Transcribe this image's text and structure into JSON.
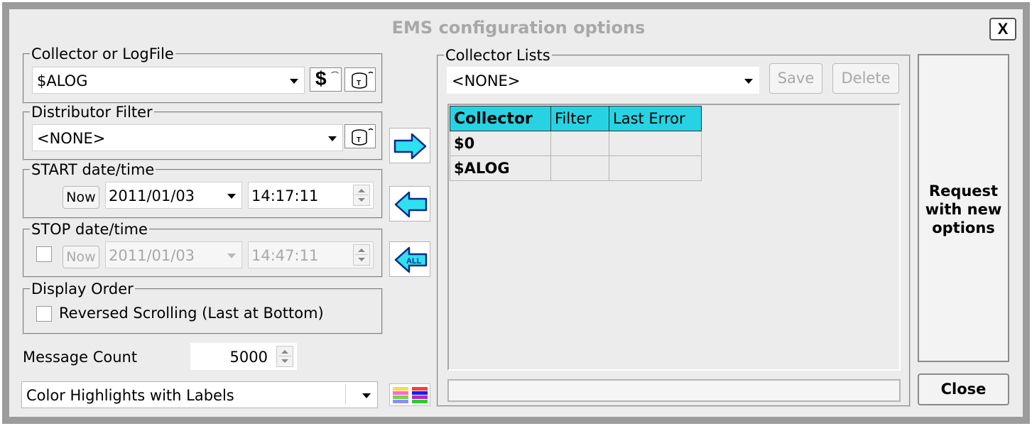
{
  "dialog": {
    "title": "EMS configuration options",
    "close_x": "X"
  },
  "collector_group": {
    "legend": "Collector or LogFile",
    "value": "$ALOG"
  },
  "distributor_group": {
    "legend": "Distributor Filter",
    "value": "<NONE>"
  },
  "start_group": {
    "legend": "START date/time",
    "now_label": "Now",
    "date": "2011/01/03",
    "time": "14:17:11"
  },
  "stop_group": {
    "legend": "STOP date/time",
    "now_label": "Now",
    "date": "2011/01/03",
    "time": "14:47:11",
    "enabled": false
  },
  "display_order": {
    "legend": "Display Order",
    "reversed_label": "Reversed Scrolling (Last at Bottom)",
    "reversed_checked": false
  },
  "message_count": {
    "label": "Message Count",
    "value": "5000"
  },
  "highlight": {
    "value": "Color Highlights with Labels"
  },
  "collector_lists": {
    "legend": "Collector Lists",
    "selected": "<NONE>",
    "save_label": "Save",
    "delete_label": "Delete",
    "columns": [
      "Collector",
      "Filter",
      "Last Error"
    ],
    "rows": [
      [
        "$0",
        "",
        ""
      ],
      [
        "$ALOG",
        "",
        ""
      ]
    ],
    "status": ""
  },
  "request_button": {
    "line1": "Request",
    "line2": "with new",
    "line3": "options"
  },
  "close_button": {
    "label": "Close"
  },
  "icons": {
    "collector_dollar": "dollar-icon",
    "collector_db": "database-icon",
    "distributor_db": "database-icon",
    "add_arrow": "arrow-right-icon",
    "remove_arrow": "arrow-left-icon",
    "remove_all": "arrow-left-all-icon",
    "color_palette": "color-palette-icon"
  },
  "colors": {
    "accent": "#27d3e3",
    "title_disabled": "#a8a8a8"
  }
}
